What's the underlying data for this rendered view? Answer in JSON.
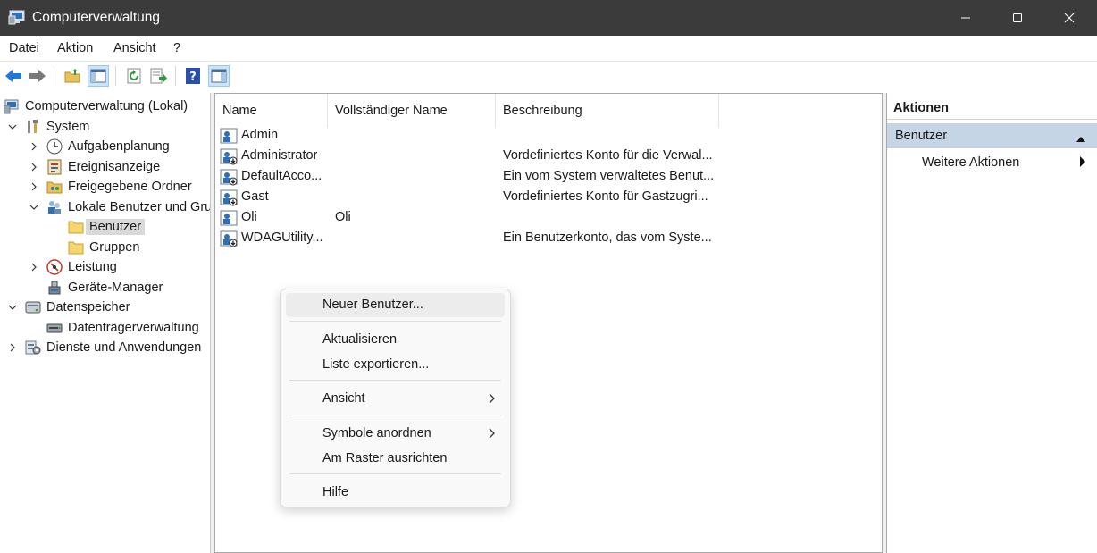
{
  "window": {
    "title": "Computerverwaltung",
    "icon": "computer-management-icon"
  },
  "menubar": {
    "items": [
      "Datei",
      "Aktion",
      "Ansicht",
      "?"
    ]
  },
  "toolbar": {
    "icons": [
      "back-icon",
      "forward-icon",
      "folder-up-icon",
      "show-hide-tree-icon",
      "refresh-icon",
      "export-list-icon",
      "help-icon",
      "show-hide-action-pane-icon"
    ]
  },
  "tree": {
    "root": "Computerverwaltung (Lokal)",
    "items": [
      {
        "label": "System"
      },
      {
        "label": "Aufgabenplanung"
      },
      {
        "label": "Ereignisanzeige"
      },
      {
        "label": "Freigegebene Ordner"
      },
      {
        "label": "Lokale Benutzer und Gruppen"
      },
      {
        "label": "Benutzer"
      },
      {
        "label": "Gruppen"
      },
      {
        "label": "Leistung"
      },
      {
        "label": "Geräte-Manager"
      },
      {
        "label": "Datenspeicher"
      },
      {
        "label": "Datenträgerverwaltung"
      },
      {
        "label": "Dienste und Anwendungen"
      }
    ]
  },
  "list": {
    "columns": [
      "Name",
      "Vollständiger Name",
      "Beschreibung"
    ],
    "rows": [
      {
        "name": "Admin",
        "fullname": "",
        "description": ""
      },
      {
        "name": "Administrator",
        "fullname": "",
        "description": "Vordefiniertes Konto für die Verwal..."
      },
      {
        "name": "DefaultAcco...",
        "fullname": "",
        "description": "Ein vom System verwaltetes Benut..."
      },
      {
        "name": "Gast",
        "fullname": "",
        "description": "Vordefiniertes Konto für Gastzugri..."
      },
      {
        "name": "Oli",
        "fullname": "Oli",
        "description": ""
      },
      {
        "name": "WDAGUtility...",
        "fullname": "",
        "description": "Ein Benutzerkonto, das vom Syste..."
      }
    ]
  },
  "context_menu": {
    "items": [
      {
        "label": "Neuer Benutzer..."
      },
      {
        "label": "Aktualisieren"
      },
      {
        "label": "Liste exportieren..."
      },
      {
        "label": "Ansicht"
      },
      {
        "label": "Symbole anordnen"
      },
      {
        "label": "Am Raster ausrichten"
      },
      {
        "label": "Hilfe"
      }
    ]
  },
  "actions": {
    "header": "Aktionen",
    "section": "Benutzer",
    "more": "Weitere Aktionen"
  },
  "colors": {
    "titlebar": "#3b3b3b",
    "action_section_bg": "#c6d5e6",
    "selection": "#d9d9d9",
    "menu_hover": "#ececec"
  }
}
